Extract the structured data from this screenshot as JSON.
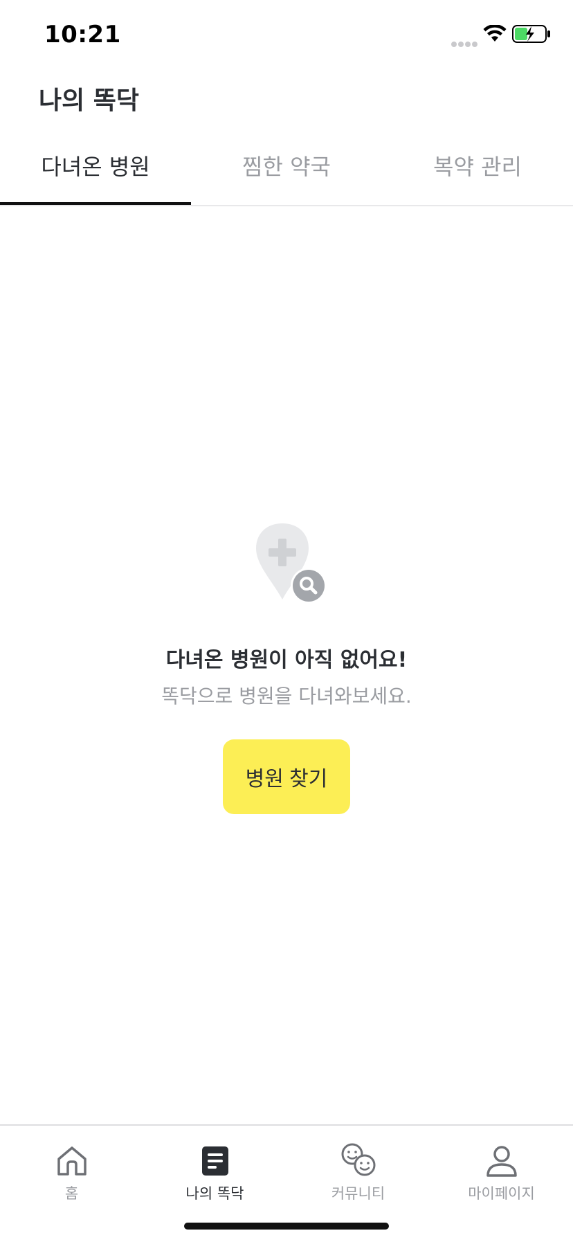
{
  "status_bar": {
    "time": "10:21"
  },
  "header": {
    "title": "나의 똑닥"
  },
  "tabs": [
    {
      "label": "다녀온 병원",
      "active": true
    },
    {
      "label": "찜한 약국",
      "active": false
    },
    {
      "label": "복약 관리",
      "active": false
    }
  ],
  "empty_state": {
    "icon": "hospital-search-icon",
    "title": "다녀온 병원이 아직 없어요!",
    "subtitle": "똑닥으로 병원을 다녀와보세요.",
    "button_label": "병원 찾기"
  },
  "bottom_nav": [
    {
      "label": "홈",
      "icon": "home-icon",
      "active": false
    },
    {
      "label": "나의 똑닥",
      "icon": "document-icon",
      "active": true
    },
    {
      "label": "커뮤니티",
      "icon": "community-icon",
      "active": false
    },
    {
      "label": "마이페이지",
      "icon": "person-icon",
      "active": false
    }
  ],
  "colors": {
    "accent_yellow": "#fcee55",
    "text_dark": "#2b2e33",
    "text_muted": "#9a9ca1"
  }
}
